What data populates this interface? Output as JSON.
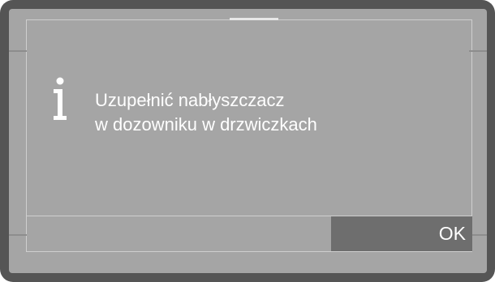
{
  "dialog": {
    "icon": "info-icon",
    "message_line1": "Uzupełnić nabłyszczacz",
    "message_line2": "w dozowniku w drzwiczkach",
    "ok_label": "OK"
  },
  "colors": {
    "bezel": "#555555",
    "screen": "#a5a5a5",
    "button": "#6e6e6e",
    "text": "#ffffff"
  }
}
